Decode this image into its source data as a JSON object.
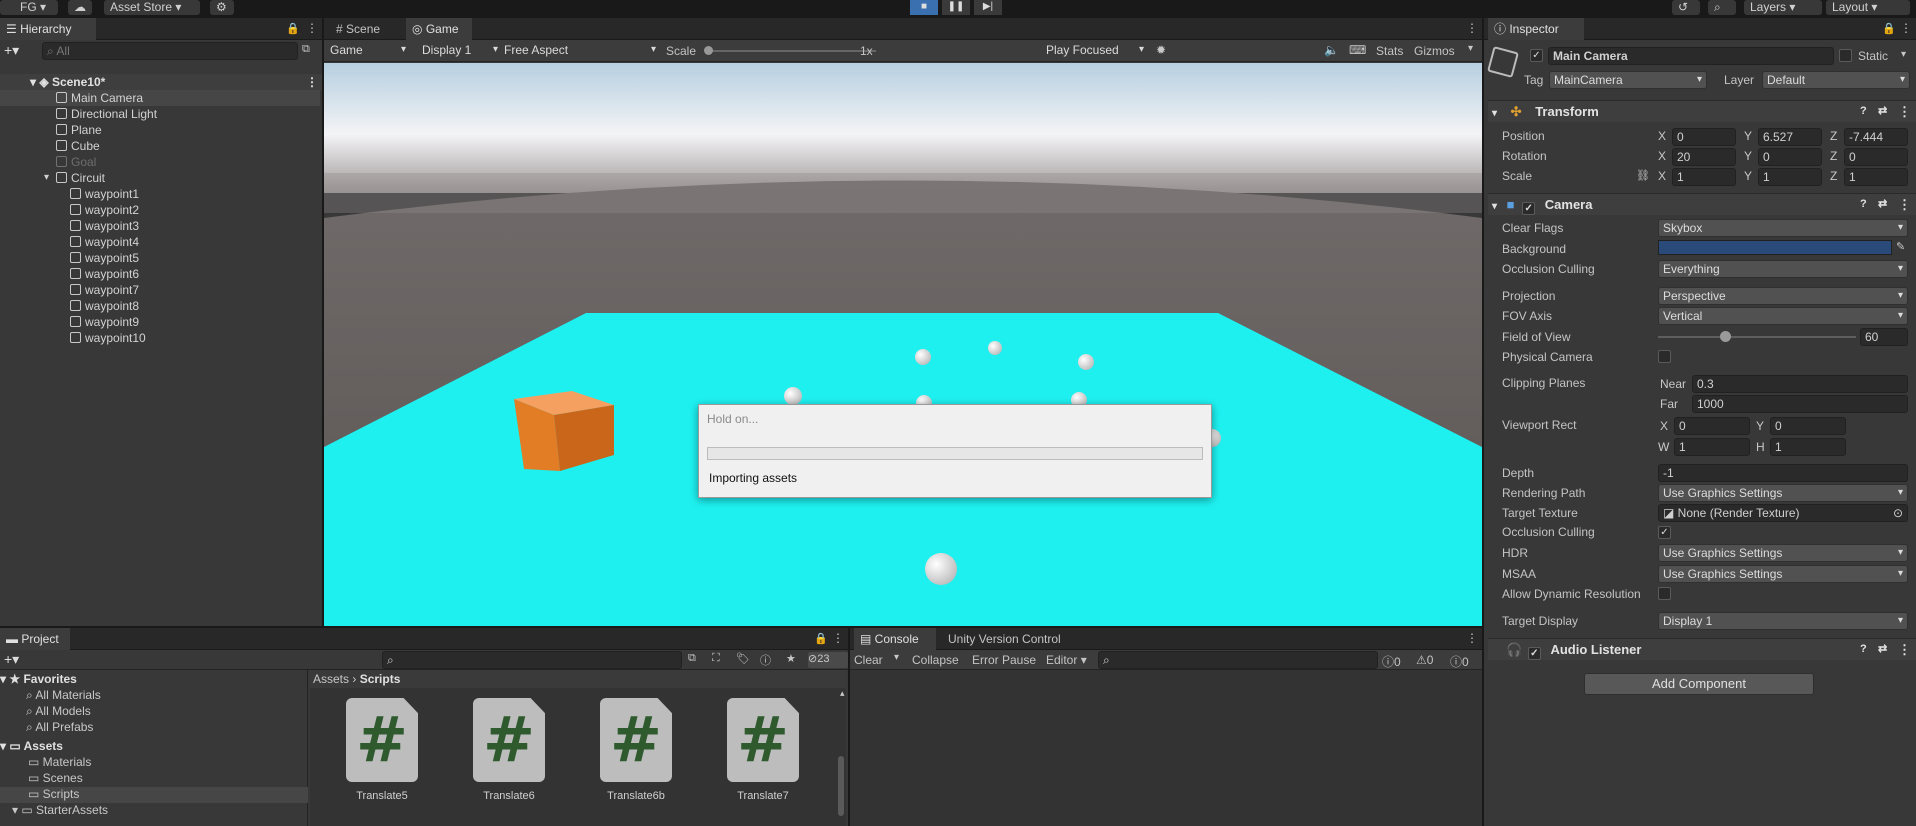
{
  "toolbar": {
    "account": "FG",
    "asset_store": "Asset Store",
    "layers": "Layers",
    "layout": "Layout"
  },
  "hierarchy": {
    "tab": "Hierarchy",
    "search_placeholder": "All",
    "scene": "Scene10*",
    "items": [
      {
        "label": "Main Camera"
      },
      {
        "label": "Directional Light"
      },
      {
        "label": "Plane"
      },
      {
        "label": "Cube"
      },
      {
        "label": "Goal"
      },
      {
        "label": "Circuit"
      },
      {
        "label": "waypoint1"
      },
      {
        "label": "waypoint2"
      },
      {
        "label": "waypoint3"
      },
      {
        "label": "waypoint4"
      },
      {
        "label": "waypoint5"
      },
      {
        "label": "waypoint6"
      },
      {
        "label": "waypoint7"
      },
      {
        "label": "waypoint8"
      },
      {
        "label": "waypoint9"
      },
      {
        "label": "waypoint10"
      }
    ]
  },
  "game_view": {
    "tabs": [
      "Scene",
      "Game"
    ],
    "mode": "Game",
    "display": "Display 1",
    "aspect": "Free Aspect",
    "scale_label": "Scale",
    "scale_value": "1x",
    "play_mode": "Play Focused",
    "stats": "Stats",
    "gizmos": "Gizmos"
  },
  "dialog": {
    "title": "Hold on...",
    "message": "Importing assets",
    "progress": 0
  },
  "inspector": {
    "tab": "Inspector",
    "object_name": "Main Camera",
    "static_label": "Static",
    "tag_label": "Tag",
    "tag_value": "MainCamera",
    "layer_label": "Layer",
    "layer_value": "Default",
    "transform": {
      "title": "Transform",
      "position_label": "Position",
      "rotation_label": "Rotation",
      "scale_label": "Scale",
      "position": {
        "x": "0",
        "y": "6.527",
        "z": "-7.444"
      },
      "rotation": {
        "x": "20",
        "y": "0",
        "z": "0"
      },
      "scale": {
        "x": "1",
        "y": "1",
        "z": "1"
      }
    },
    "camera": {
      "title": "Camera",
      "clear_flags_label": "Clear Flags",
      "clear_flags": "Skybox",
      "background_label": "Background",
      "background_color": "#2a4a7a",
      "occlusion_label": "Occlusion Culling",
      "occlusion_value": "Everything",
      "projection_label": "Projection",
      "projection": "Perspective",
      "fov_axis_label": "FOV Axis",
      "fov_axis": "Vertical",
      "fov_label": "Field of View",
      "fov_value": "60",
      "fov_fraction": 0.34,
      "physical_label": "Physical Camera",
      "clipping_label": "Clipping Planes",
      "near_label": "Near",
      "near": "0.3",
      "far_label": "Far",
      "far": "1000",
      "viewport_label": "Viewport Rect",
      "vx": "0",
      "vy": "0",
      "vw": "1",
      "vh": "1",
      "depth_label": "Depth",
      "depth": "-1",
      "rendering_path_label": "Rendering Path",
      "rendering_path": "Use Graphics Settings",
      "target_texture_label": "Target Texture",
      "target_texture": "None (Render Texture)",
      "occlusion2_label": "Occlusion Culling",
      "hdr_label": "HDR",
      "hdr": "Use Graphics Settings",
      "msaa_label": "MSAA",
      "msaa": "Use Graphics Settings",
      "dynres_label": "Allow Dynamic Resolution",
      "target_display_label": "Target Display",
      "target_display": "Display 1"
    },
    "audio_listener": "Audio Listener",
    "add_component": "Add Component"
  },
  "project": {
    "tab": "Project",
    "favorites": "Favorites",
    "fav_items": [
      "All Materials",
      "All Models",
      "All Prefabs"
    ],
    "assets": "Assets",
    "asset_folders": [
      "Materials",
      "Scenes",
      "Scripts",
      "StarterAssets"
    ],
    "breadcrumb_root": "Assets",
    "breadcrumb_current": "Scripts",
    "hidden_count": "23",
    "files": [
      "Translate5",
      "Translate6",
      "Translate6b",
      "Translate7"
    ]
  },
  "console": {
    "tabs": [
      "Console",
      "Unity Version Control"
    ],
    "clear": "Clear",
    "collapse": "Collapse",
    "error_pause": "Error Pause",
    "editor": "Editor",
    "log_count": "0",
    "warn_count": "0",
    "error_count": "0"
  }
}
